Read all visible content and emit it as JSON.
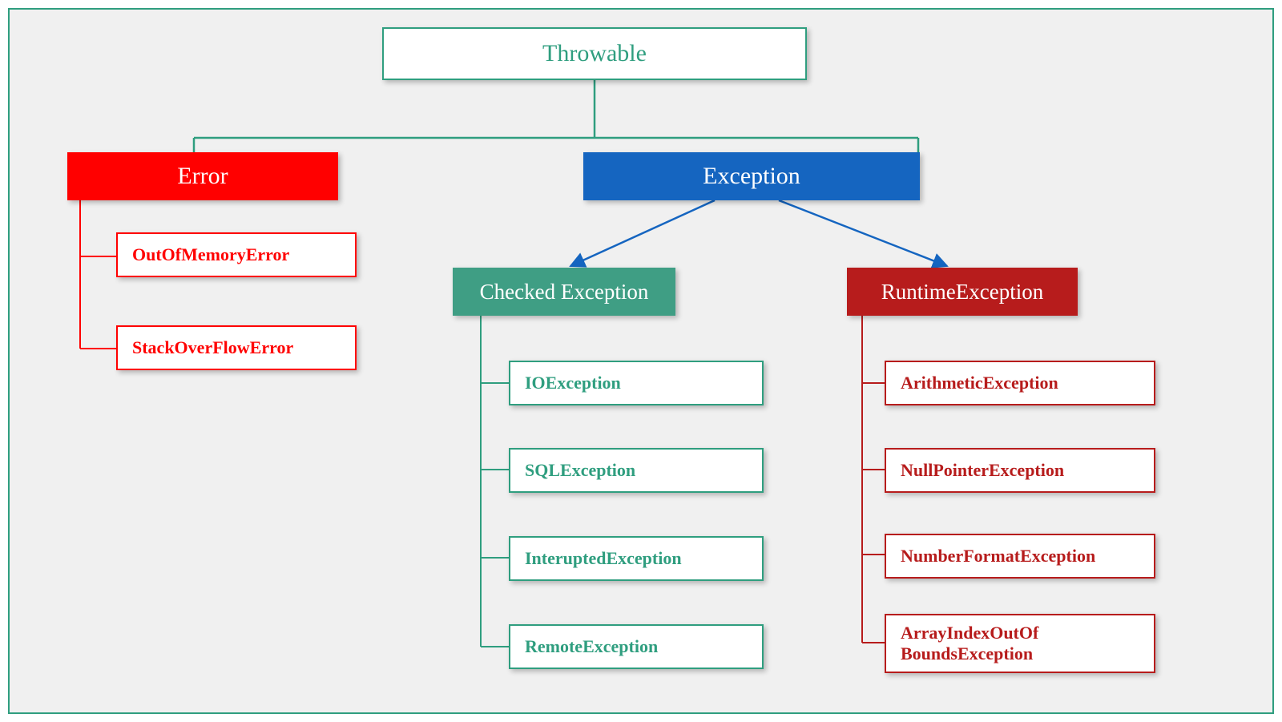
{
  "root": "Throwable",
  "error": {
    "title": "Error",
    "children": [
      "OutOfMemoryError",
      "StackOverFlowError"
    ]
  },
  "exception": {
    "title": "Exception",
    "checked": {
      "title": "Checked Exception",
      "children": [
        "IOException",
        "SQLException",
        "InteruptedException",
        "RemoteException"
      ]
    },
    "runtime": {
      "title": "RuntimeException",
      "children": [
        "ArithmeticException",
        "NullPointerException",
        "NumberFormatException",
        "ArrayIndexOutOf BoundsException"
      ]
    }
  },
  "colors": {
    "teal": "#2f9e7f",
    "tealFill": "#3f9e84",
    "red": "#ff0000",
    "blue": "#1565c0",
    "darkred": "#b71c1c"
  }
}
